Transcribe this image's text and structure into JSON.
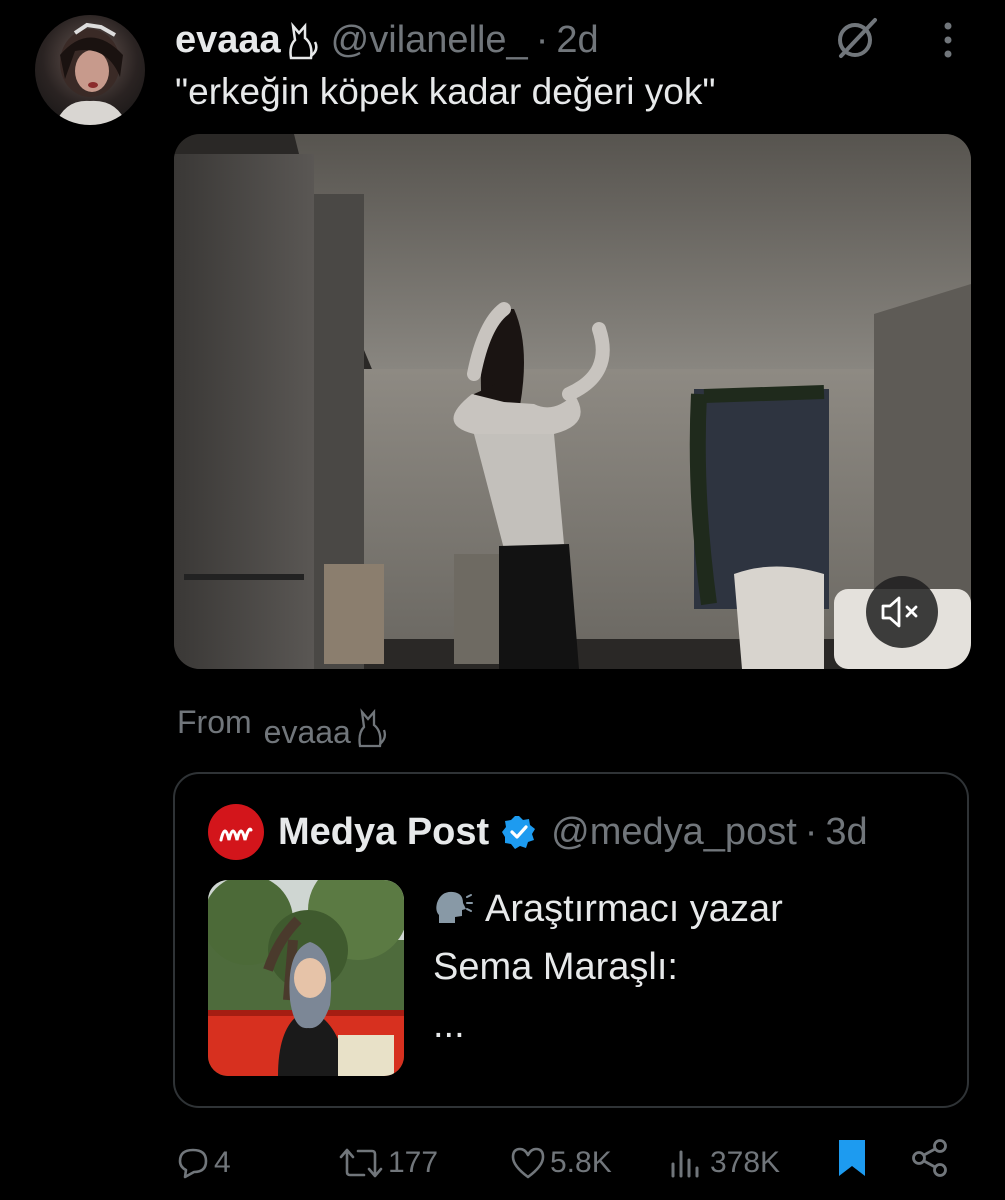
{
  "tweet": {
    "display_name": "evaaa",
    "handle": "@vilanelle_",
    "separator": "·",
    "time": "2d",
    "text": "\"erkeğin köpek kadar değeri yok\""
  },
  "media": {
    "mute_icon": "mute-speaker-icon"
  },
  "from": {
    "label": "From",
    "name": "evaaa"
  },
  "quoted_tweet": {
    "display_name": "Medya Post",
    "logo_text": "M",
    "handle": "@medya_post",
    "separator": "·",
    "time": "3d",
    "text_line1": "Araştırmacı yazar",
    "text_line2": "Sema Maraşlı:",
    "text_line3": "..."
  },
  "actions": {
    "replies": "4",
    "reposts": "177",
    "likes": "5.8K",
    "views": "378K"
  },
  "colors": {
    "background": "#000000",
    "text_primary": "#e7e9ea",
    "text_secondary": "#71767b",
    "border": "#2f3336",
    "bookmark_active": "#1d9bf0",
    "verified": "#1d9bf0",
    "medya_brand": "#d3151b"
  }
}
